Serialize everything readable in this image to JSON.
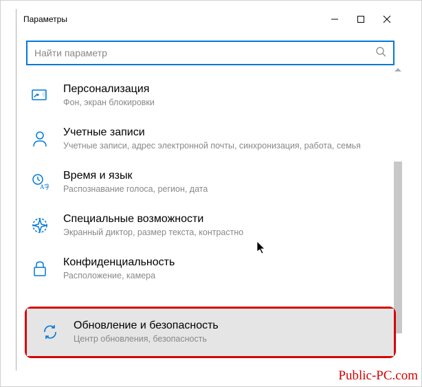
{
  "window": {
    "title": "Параметры"
  },
  "search": {
    "placeholder": "Найти параметр"
  },
  "items": [
    {
      "title": "Персонализация",
      "desc": "Фон, экран блокировки"
    },
    {
      "title": "Учетные записи",
      "desc": "Учетные записи, адрес электронной почты, синхронизация, работа, семья"
    },
    {
      "title": "Время и язык",
      "desc": "Распознавание голоса, регион, дата"
    },
    {
      "title": "Специальные возможности",
      "desc": "Экранный диктор, размер текста, контрастно"
    },
    {
      "title": "Конфиденциальность",
      "desc": "Расположение, камера"
    },
    {
      "title": "Обновление и безопасность",
      "desc": "Центр обновления, безопасность"
    }
  ],
  "watermark": "Public-PC.com"
}
